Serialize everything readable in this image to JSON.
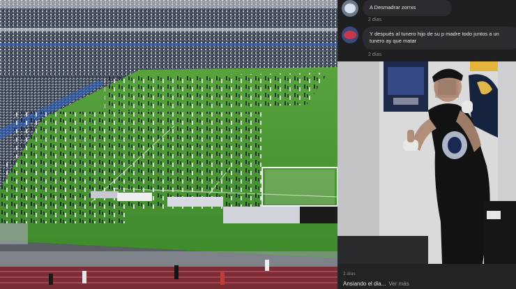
{
  "left_panel": {
    "scene": "stadium-pitch-invasion-photo"
  },
  "right_panel": {
    "comments": [
      {
        "text": "A Desmadrar zorrxs",
        "time": "2 días"
      },
      {
        "text": "Y después al tunero hijo de su p      madre todo juntos a un tunero ay que matar",
        "time": "2 días"
      }
    ],
    "post": {
      "time": "2 días",
      "caption": "Ansiando el dia...",
      "more_label": "Ver más"
    }
  }
}
